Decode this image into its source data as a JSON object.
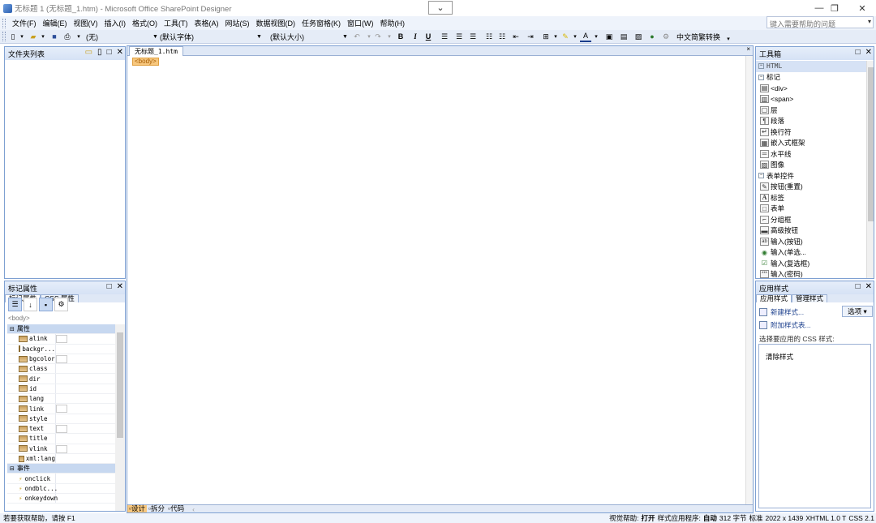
{
  "window": {
    "title": "无标题 1 (无标题_1.htm) - Microsoft Office SharePoint Designer",
    "minimize": "—",
    "restore": "❐",
    "close": "✕"
  },
  "menu": {
    "items": [
      "文件(F)",
      "编辑(E)",
      "视图(V)",
      "插入(I)",
      "格式(O)",
      "工具(T)",
      "表格(A)",
      "网站(S)",
      "数据视图(D)",
      "任务窗格(K)",
      "窗口(W)",
      "帮助(H)"
    ],
    "help_placeholder": "键入需要帮助的问题"
  },
  "toolbar": {
    "style_value": "(无)",
    "font_value": "(默认字体)",
    "size_value": "(默认大小)",
    "convert_label": "中文简繁转换"
  },
  "folder_panel": {
    "title": "文件夹列表"
  },
  "document": {
    "tab": "无标题_1.htm",
    "tag_badge": "<body>",
    "views": [
      "设计",
      "拆分",
      "代码"
    ]
  },
  "toolbox": {
    "title": "工具箱",
    "rows": [
      {
        "kind": "cat",
        "label": "HTML"
      },
      {
        "kind": "cat2",
        "label": "标记"
      },
      {
        "kind": "item",
        "icon": "div-icon",
        "glyph": "▤",
        "label": "<div>"
      },
      {
        "kind": "item",
        "icon": "span-icon",
        "glyph": "▥",
        "label": "<span>"
      },
      {
        "kind": "item",
        "icon": "layer-icon",
        "glyph": "▢",
        "label": "层"
      },
      {
        "kind": "item",
        "icon": "paragraph-icon",
        "glyph": "¶",
        "label": "段落"
      },
      {
        "kind": "item",
        "icon": "line-break-icon",
        "glyph": "↵",
        "label": "换行符"
      },
      {
        "kind": "item",
        "icon": "iframe-icon",
        "glyph": "▦",
        "label": "嵌入式框架"
      },
      {
        "kind": "item",
        "icon": "horizontal-line-icon",
        "glyph": "═",
        "label": "水平线"
      },
      {
        "kind": "item",
        "icon": "image-icon",
        "glyph": "▨",
        "label": "图像"
      },
      {
        "kind": "cat2",
        "label": "表单控件"
      },
      {
        "kind": "item",
        "icon": "reset-button-icon",
        "glyph": "✎",
        "label": "按钮(重置)"
      },
      {
        "kind": "item",
        "icon": "label-icon",
        "glyph": "A",
        "label": "标签"
      },
      {
        "kind": "item",
        "icon": "form-icon",
        "glyph": "□",
        "label": "表单"
      },
      {
        "kind": "item",
        "icon": "group-box-icon",
        "glyph": "⌐",
        "label": "分组框"
      },
      {
        "kind": "item",
        "icon": "advanced-button-icon",
        "glyph": "▬",
        "label": "高级按钮"
      },
      {
        "kind": "item",
        "icon": "input-button-icon",
        "glyph": "ab",
        "label": "输入(按钮)"
      },
      {
        "kind": "item",
        "icon": "radio-icon",
        "glyph": "◉",
        "label": "输入(单选..."
      },
      {
        "kind": "item",
        "icon": "checkbox-icon",
        "glyph": "☑",
        "label": "输入(复选框)"
      },
      {
        "kind": "item",
        "icon": "password-icon",
        "glyph": "***",
        "label": "输入(密码)"
      }
    ]
  },
  "tag_props": {
    "title": "标记属性",
    "tabs": [
      "标记属性",
      "CSS 属性"
    ],
    "path": "<body>",
    "section_attrs": "属性",
    "attrs": [
      {
        "name": "alink",
        "swatch": true
      },
      {
        "name": "backgr...",
        "swatch": false
      },
      {
        "name": "bgcolor",
        "swatch": true
      },
      {
        "name": "class",
        "swatch": false
      },
      {
        "name": "dir",
        "swatch": false
      },
      {
        "name": "id",
        "swatch": false
      },
      {
        "name": "lang",
        "swatch": false
      },
      {
        "name": "link",
        "swatch": true
      },
      {
        "name": "style",
        "swatch": false
      },
      {
        "name": "text",
        "swatch": true
      },
      {
        "name": "title",
        "swatch": false
      },
      {
        "name": "vlink",
        "swatch": true
      },
      {
        "name": "xml:lang",
        "swatch": false
      }
    ],
    "section_events": "事件",
    "events": [
      "onclick",
      "ondblc...",
      "onkeydown"
    ]
  },
  "apply_styles": {
    "title": "应用样式",
    "tabs": [
      "应用样式",
      "管理样式"
    ],
    "new_style": "新建样式...",
    "attach_sheet": "附加样式表...",
    "options": "选项 ▾",
    "select_label": "选择要应用的 CSS 样式:",
    "clear_style": "清除样式"
  },
  "status": {
    "left": "若要获取帮助，请按 F1",
    "visual_aid_label": "视觉帮助:",
    "visual_aid_value": "打开",
    "style_app_label": "样式应用程序:",
    "style_app_value": "自动",
    "size": "312 字节",
    "mode": "标准",
    "dims": "2022 x 1439",
    "schema": "XHTML 1.0 T",
    "css": "CSS 2.1"
  }
}
